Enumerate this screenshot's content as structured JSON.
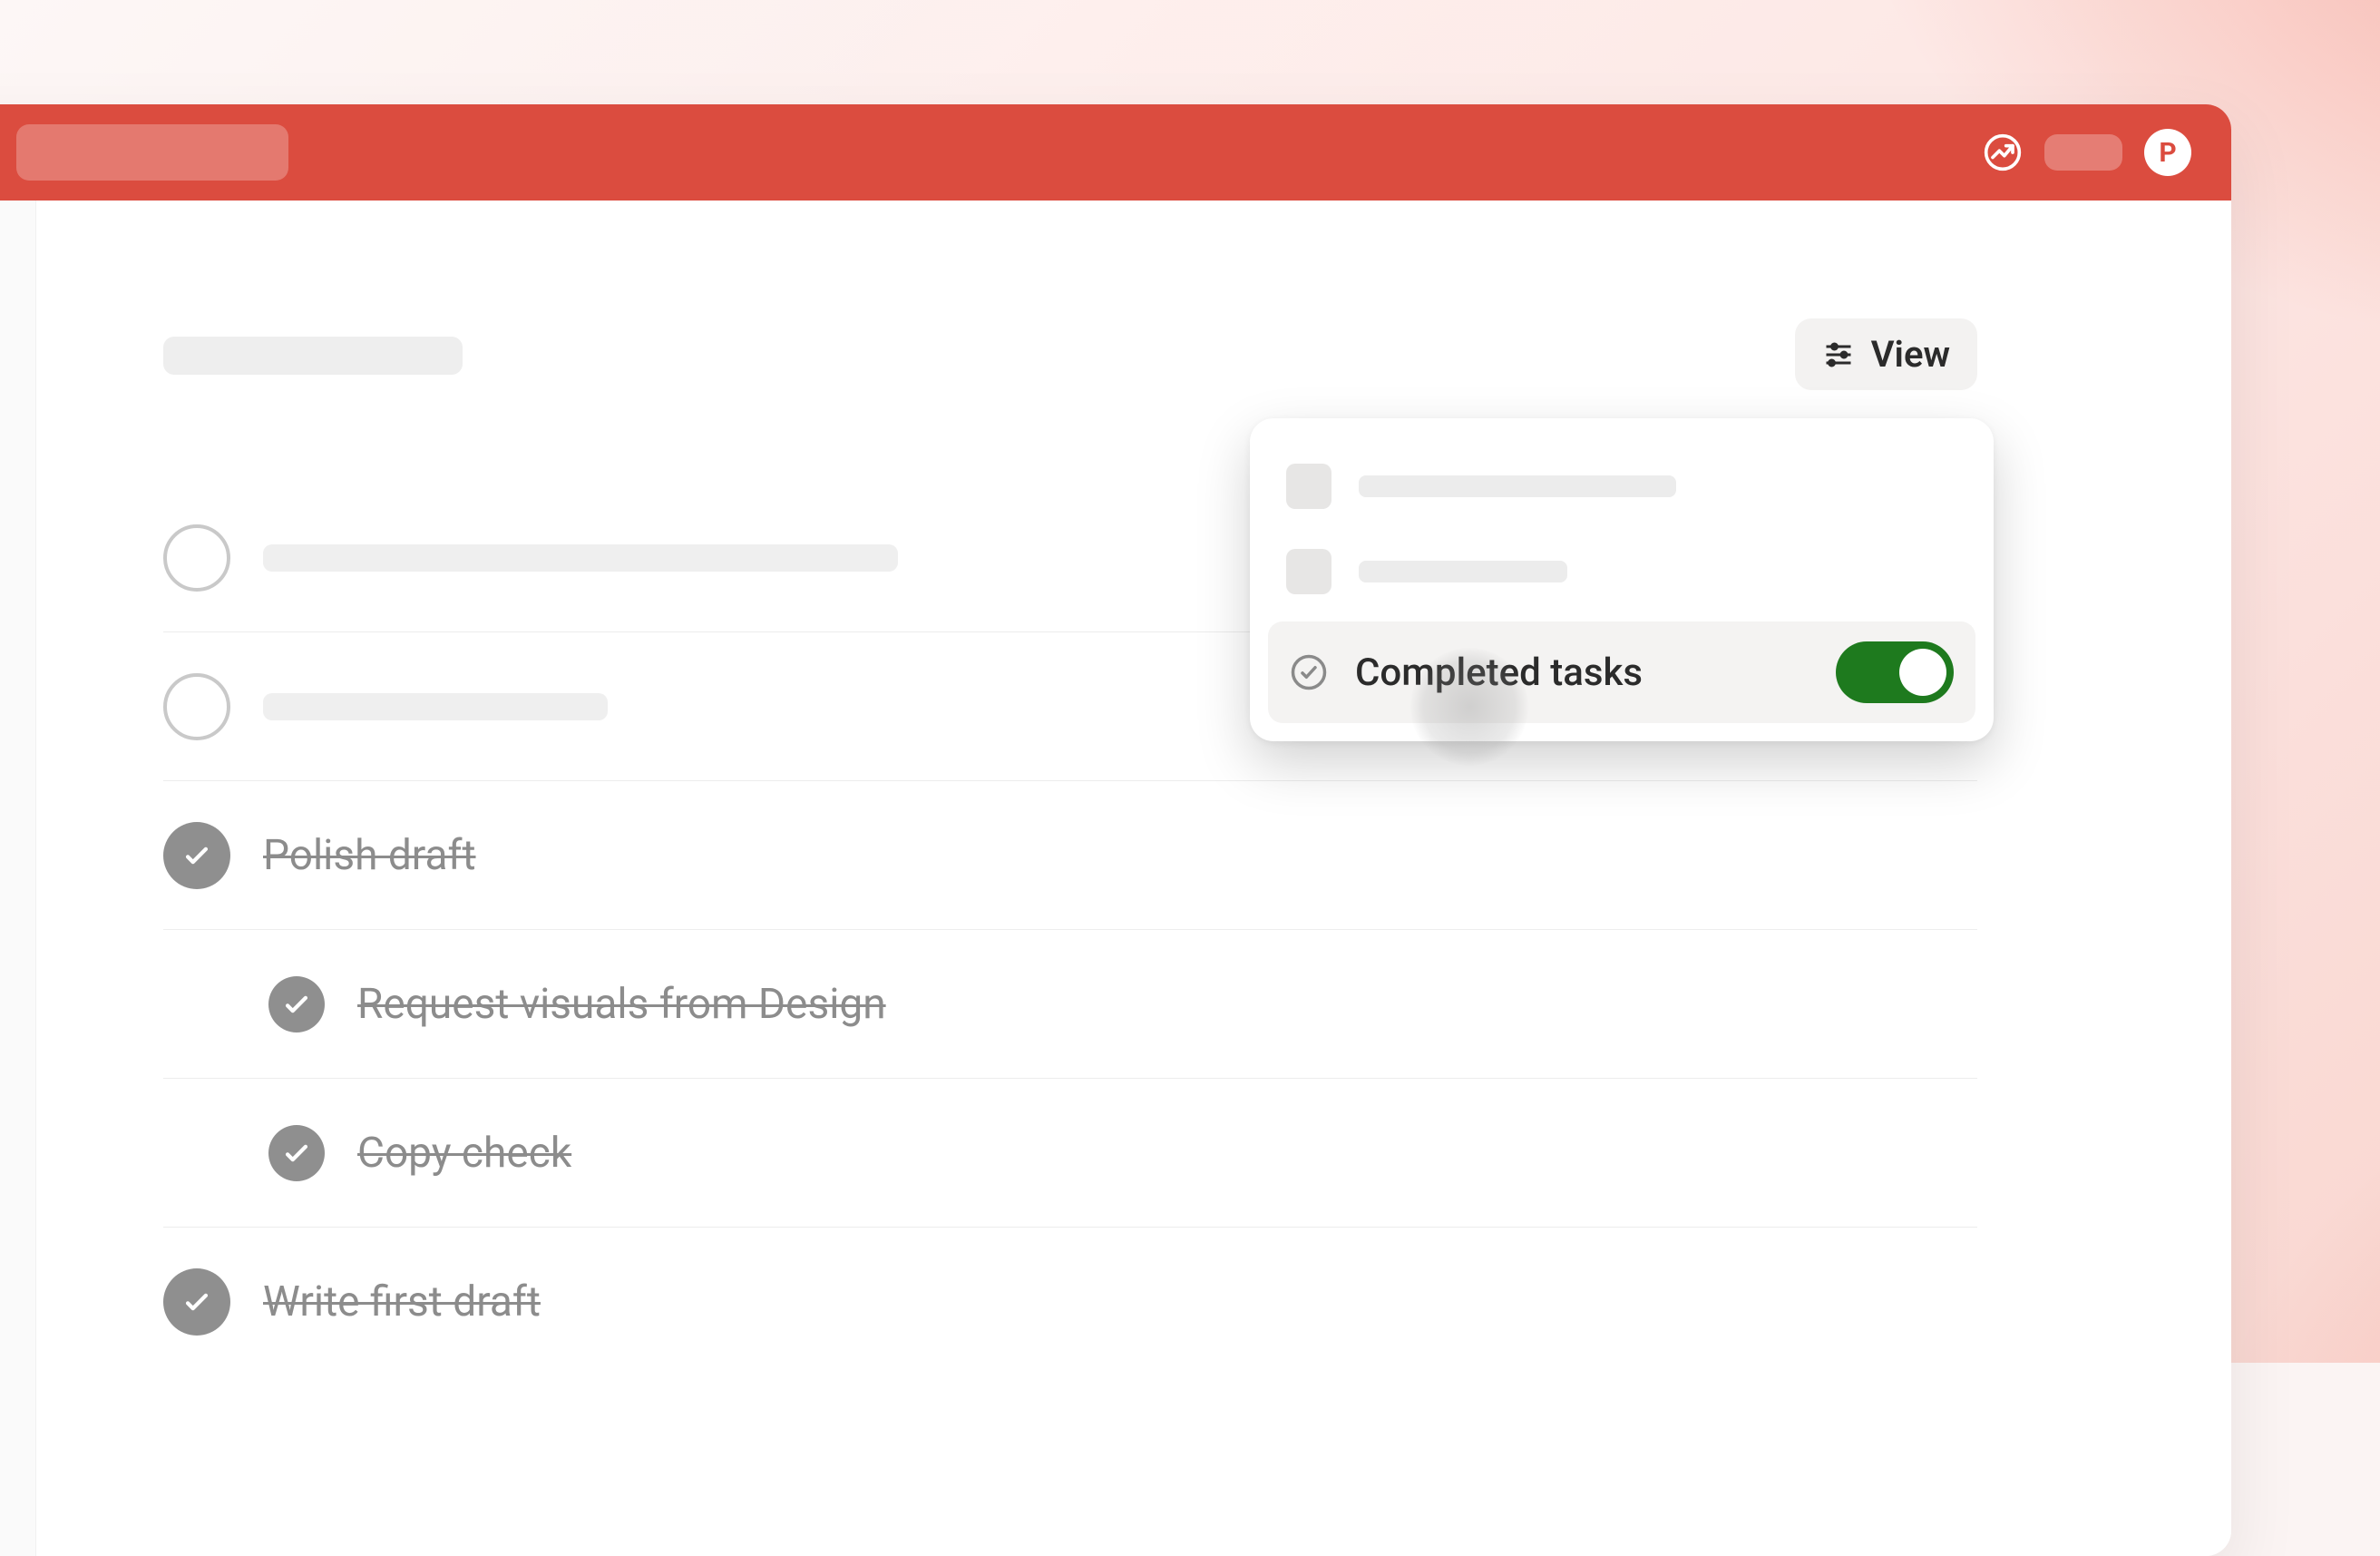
{
  "colors": {
    "accent": "#db4c3f",
    "toggle_on": "#1e7a1e"
  },
  "header": {
    "avatar_initial": "P"
  },
  "view_button": {
    "label": "View"
  },
  "popover": {
    "completed_tasks": {
      "label": "Completed tasks",
      "enabled": true
    }
  },
  "tasks": [
    {
      "completed": false
    },
    {
      "completed": false
    },
    {
      "completed": true,
      "title": "Polish draft"
    },
    {
      "completed": true,
      "title": "Request visuals from Design",
      "subtask": true
    },
    {
      "completed": true,
      "title": "Copy check",
      "subtask": true
    },
    {
      "completed": true,
      "title": "Write first draft"
    }
  ]
}
